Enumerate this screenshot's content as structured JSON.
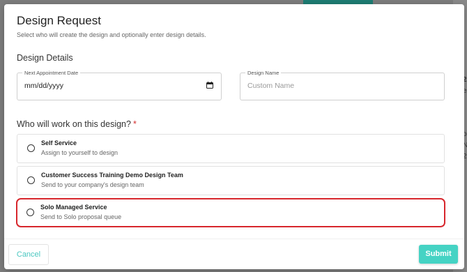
{
  "dialog": {
    "title": "Design Request",
    "subtitle": "Select who will create the design and optionally enter design details."
  },
  "design_details": {
    "heading": "Design Details",
    "appointment_date": {
      "label": "Next Appointment Date",
      "value": "mm/dd/yyyy",
      "icon": "calendar-icon"
    },
    "design_name": {
      "label": "Design Name",
      "placeholder": "Custom Name"
    }
  },
  "who_will_work": {
    "question": "Who will work on this design?",
    "required_marker": "*",
    "options": [
      {
        "title": "Self Service",
        "description": "Assign to yourself to design",
        "selected": false
      },
      {
        "title": "Customer Success Training Demo Design Team",
        "description": "Send to your company's design team",
        "selected": false
      },
      {
        "title": "Solo Managed Service",
        "description": "Send to Solo proposal queue",
        "selected": false,
        "highlighted": true
      }
    ]
  },
  "footer": {
    "cancel_label": "Cancel",
    "submit_label": "Submit"
  },
  "background_fragments": [
    "2",
    "ea",
    "o",
    "N",
    "2"
  ],
  "colors": {
    "accent": "#45d3c4",
    "cancel_text": "#4bc7c0",
    "highlight_border": "#d7262c",
    "required": "#d32f2f"
  }
}
